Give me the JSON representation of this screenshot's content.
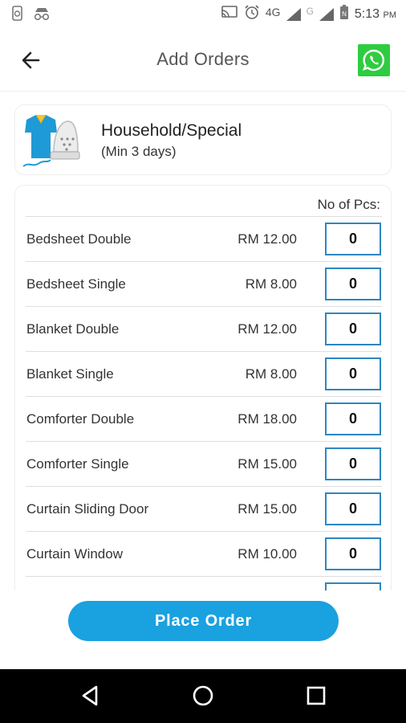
{
  "status_bar": {
    "network": "4G",
    "network2": "G",
    "time": "5:13",
    "ampm": "PM",
    "icons": [
      "screenshot-icon",
      "incognito-icon",
      "cast-icon",
      "alarm-icon",
      "signal-icon",
      "signal-icon",
      "battery-icon"
    ]
  },
  "header": {
    "title": "Add Orders",
    "back_icon": "arrow-left-icon",
    "whatsapp_icon": "whatsapp-icon"
  },
  "category": {
    "title": "Household/Special",
    "subtitle": "(Min 3 days)",
    "image": "shirt-iron-icon"
  },
  "items_table": {
    "qty_header": "No of Pcs:",
    "items": [
      {
        "name": "Bedsheet Double",
        "price": "RM 12.00",
        "qty": "0"
      },
      {
        "name": "Bedsheet Single",
        "price": "RM 8.00",
        "qty": "0"
      },
      {
        "name": "Blanket Double",
        "price": "RM 12.00",
        "qty": "0"
      },
      {
        "name": "Blanket Single",
        "price": "RM 8.00",
        "qty": "0"
      },
      {
        "name": "Comforter Double",
        "price": "RM 18.00",
        "qty": "0"
      },
      {
        "name": "Comforter Single",
        "price": "RM 15.00",
        "qty": "0"
      },
      {
        "name": "Curtain Sliding Door",
        "price": "RM 15.00",
        "qty": "0"
      },
      {
        "name": "Curtain Window",
        "price": "RM 10.00",
        "qty": "0"
      }
    ]
  },
  "place_order": {
    "label": "Place Order"
  },
  "colors": {
    "accent": "#1aa1e0",
    "qty_border": "#2e86c1",
    "whatsapp": "#2ecc40"
  },
  "nav": {
    "icons": [
      "nav-back-icon",
      "nav-home-icon",
      "nav-recent-icon"
    ]
  }
}
